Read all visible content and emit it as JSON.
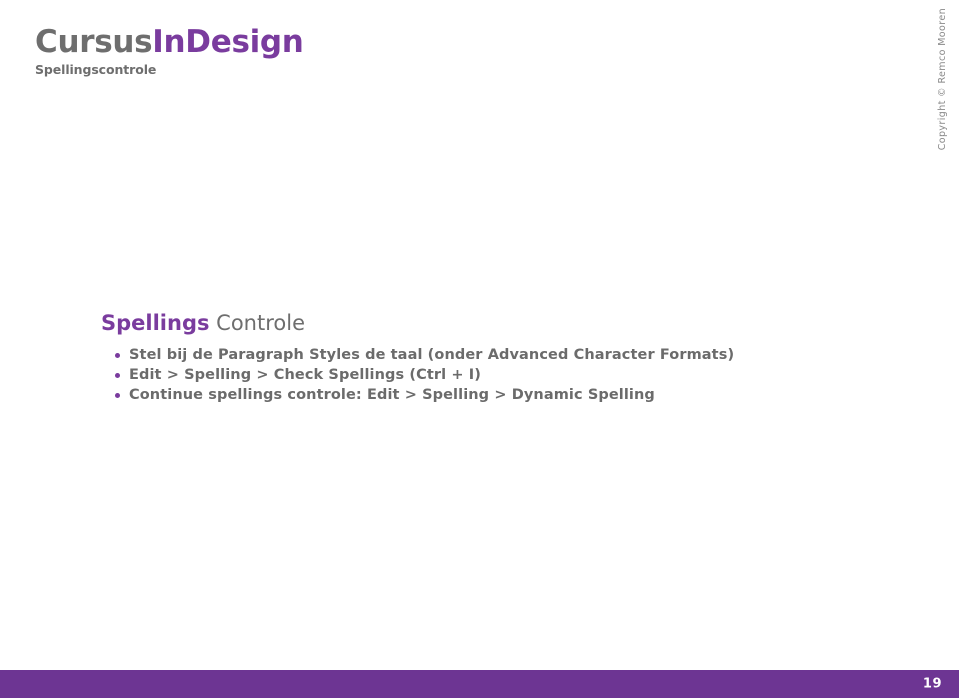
{
  "slide": {
    "background_color": "#ffffff",
    "accent_purple": "#7a3c9e",
    "bar_purple": "#6d3593",
    "text_gray": "#6b6b6b"
  },
  "logo": {
    "title_first": "Cursus",
    "title_second": "InDesign",
    "subtitle": "Spellingscontrole"
  },
  "copyright": {
    "text": "Copyright © Remco Mooren"
  },
  "main": {
    "heading_highlight": "Spellings",
    "heading_rest": " Controle",
    "bullets": [
      {
        "text": "Stel bij de Paragraph Styles de taal (onder Advanced Character Formats)"
      },
      {
        "text": "Edit > Spelling > Check Spellings (Ctrl + I)"
      },
      {
        "text": "Continue spellings controle: Edit > Spelling > Dynamic Spelling"
      }
    ]
  },
  "footer": {
    "page_number": "19"
  }
}
